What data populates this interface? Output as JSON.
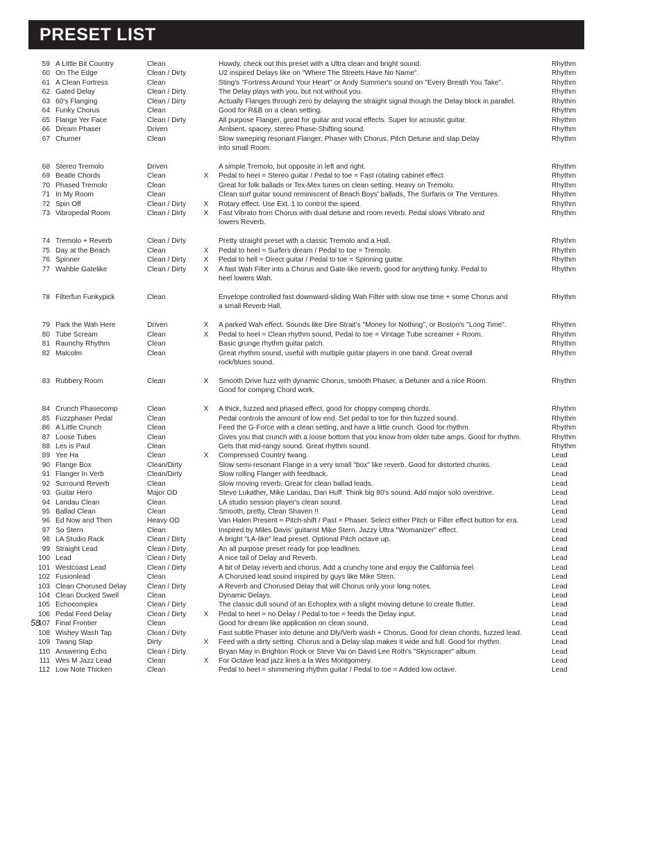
{
  "header": {
    "title": "PRESET LIST",
    "bar_color": "#231f20",
    "text_color": "#ffffff"
  },
  "page_number": "58",
  "columns": {
    "number": "",
    "name": "",
    "type": "",
    "pedal": "",
    "description": "",
    "category": ""
  },
  "rows": [
    {
      "num": "59",
      "name": "A Little Bit Country",
      "type": "Clean",
      "x": "",
      "desc": "Howdy, check out this preset with a Ultra clean and bright sound.",
      "cat": "Rhythm"
    },
    {
      "num": "60",
      "name": "On The Edge",
      "type": "Clean / Dirty",
      "x": "",
      "desc": "U2 inspired Delays like on \"Where The Streets Have No Name\".",
      "cat": "Rhythm"
    },
    {
      "num": "61",
      "name": "A Clean Fortress",
      "type": "Clean",
      "x": "",
      "desc": "Sting's \"Fortress Around Your Heart\" or Andy Summer's sound on \"Every Breath You Take\".",
      "cat": "Rhythm"
    },
    {
      "num": "62",
      "name": "Gated Delay",
      "type": "Clean / Dirty",
      "x": "",
      "desc": "The Delay plays with you, but not without you.",
      "cat": "Rhythm"
    },
    {
      "num": "63",
      "name": "60's Flanging",
      "type": "Clean / Dirty",
      "x": "",
      "desc": "Actually Flanges through zero by delaying the straight signal though the Delay block in parallel.",
      "cat": "Rhythm"
    },
    {
      "num": "64",
      "name": "Funky Chorus",
      "type": "Clean",
      "x": "",
      "desc": "Good for R&B on a clean setting.",
      "cat": "Rhythm"
    },
    {
      "num": "65",
      "name": "Flange Yer Face",
      "type": "Clean / Dirty",
      "x": "",
      "desc": "All purpose Flanger, great for guitar and vocal effects. Super for acoustic guitar.",
      "cat": "Rhythm"
    },
    {
      "num": "66",
      "name": "Dream Phaser",
      "type": "Driven",
      "x": "",
      "desc": "Ambient, spacey, stereo Phase-Shifting sound.",
      "cat": "Rhythm"
    },
    {
      "num": "67",
      "name": "Churner",
      "type": "Clean",
      "x": "",
      "desc": "Slow sweeping resonant Flanger, Phaser with Chorus, Pitch Detune and slap Delay",
      "cat": "Rhythm"
    },
    {
      "num": "",
      "name": "",
      "type": "",
      "x": "",
      "desc": "into small Room.",
      "cat": ""
    },
    {
      "spacer": true
    },
    {
      "num": "68",
      "name": "Stereo Tremolo",
      "type": "Driven",
      "x": "",
      "desc": "A simple Tremolo, but opposite in left and right.",
      "cat": "Rhythm"
    },
    {
      "num": "69",
      "name": "Beatle Chords",
      "type": "Clean",
      "x": "X",
      "desc": "Pedal to heel = Stereo guitar / Pedal to toe = Fast rotating cabinet effect.",
      "cat": "Rhythm"
    },
    {
      "num": "70",
      "name": "Phased Tremolo",
      "type": "Clean",
      "x": "",
      "desc": "Great for folk ballads or Tex-Mex tunes on clean setting. Heavy on Tremolo.",
      "cat": "Rhythm"
    },
    {
      "num": "71",
      "name": "In My Room",
      "type": "Clean",
      "x": "",
      "desc": "Clean surf guitar sound reminiscent of Beach Boys' ballads, The Surfaris or The Ventures.",
      "cat": "Rhythm"
    },
    {
      "num": "72",
      "name": "Spin Off",
      "type": "Clean / Dirty",
      "x": "X",
      "desc": "Rotary effect. Use Ext. 1 to control the speed.",
      "cat": "Rhythm"
    },
    {
      "num": "73",
      "name": "Vibropedal Room",
      "type": "Clean / Dirty",
      "x": "X",
      "desc": "Fast Vibrato from Chorus with dual detune and room reverb. Pedal slows Vibrato and",
      "cat": "Rhythm"
    },
    {
      "num": "",
      "name": "",
      "type": "",
      "x": "",
      "desc": "lowers Reverb.",
      "cat": ""
    },
    {
      "spacer": true
    },
    {
      "num": "74",
      "name": "Tremolo + Reverb",
      "type": "Clean / Dirty",
      "x": "",
      "desc": "Pretty straight preset with a classic Tremolo and a Hall.",
      "cat": "Rhythm"
    },
    {
      "num": "75",
      "name": "Day at the Beach",
      "type": "Clean",
      "x": "X",
      "desc": "Pedal to heel = Surfers dream / Pedal to toe = Tremolo.",
      "cat": "Rhythm"
    },
    {
      "num": "76",
      "name": "Spinner",
      "type": "Clean / Dirty",
      "x": "X",
      "desc": "Pedal to hell = Direct guitar / Pedal to toe = Spinning guitar.",
      "cat": "Rhythm"
    },
    {
      "num": "77",
      "name": "Wahble Gatelike",
      "type": "Clean / Dirty",
      "x": "X",
      "desc": "A fast Wah Filter into a Chorus and Gate-like reverb, good for anything funky. Pedal to",
      "cat": "Rhythm"
    },
    {
      "num": "",
      "name": "",
      "type": "",
      "x": "",
      "desc": "heel lowers Wah.",
      "cat": ""
    },
    {
      "spacer": true
    },
    {
      "num": "78",
      "name": "Filterfun Funkypick",
      "type": "Clean",
      "x": "",
      "desc": "Envelope controlled fast downward-sliding Wah Filter with slow rise time + some Chorus and",
      "cat": "Rhythm"
    },
    {
      "num": "",
      "name": "",
      "type": "",
      "x": "",
      "desc": "a small Reverb Hall.",
      "cat": ""
    },
    {
      "spacer": true
    },
    {
      "num": "79",
      "name": "Park the Wah Here",
      "type": "Driven",
      "x": "X",
      "desc": "A parked Wah effect. Sounds like Dire Strait's \"Money for Nothing\", or Boston's \"Long Time\".",
      "cat": "Rhythm"
    },
    {
      "num": "80",
      "name": "Tube Scream",
      "type": "Clean",
      "x": "X",
      "desc": "Pedal to heel = Clean rhythm sound, Pedal to toe = Vintage Tube screamer + Room.",
      "cat": "Rhythm"
    },
    {
      "num": "81",
      "name": "Raunchy Rhythm",
      "type": "Clean",
      "x": "",
      "desc": "Basic grunge rhythm guitar patch.",
      "cat": "Rhythm"
    },
    {
      "num": "82",
      "name": "Malcolm",
      "type": "Clean",
      "x": "",
      "desc": "Great rhythm sound, useful with multiple guitar players in one band. Great overall",
      "cat": "Rhythm"
    },
    {
      "num": "",
      "name": "",
      "type": "",
      "x": "",
      "desc": "rock/blues sound.",
      "cat": ""
    },
    {
      "spacer": true
    },
    {
      "num": "83",
      "name": "Rubbery Room",
      "type": "Clean",
      "x": "X",
      "desc": "Smooth Drive fuzz with dynamic Chorus, smooth Phaser, a Detuner and a nice Room.",
      "cat": "Rhythm"
    },
    {
      "num": "",
      "name": "",
      "type": "",
      "x": "",
      "desc": "Good for comping Chord work.",
      "cat": ""
    },
    {
      "spacer": true
    },
    {
      "num": "84",
      "name": "Crunch Phasecomp",
      "type": "Clean",
      "x": "X",
      "desc": "A thick, fuzzed and phased effect, good for choppy comping chords.",
      "cat": "Rhythm"
    },
    {
      "num": "85",
      "name": "Fuzzphaser Pedal",
      "type": "Clean",
      "x": "",
      "desc": "Pedal controls the amount of low end. Set pedal to toe for thin fuzzed sound.",
      "cat": "Rhythm"
    },
    {
      "num": "86",
      "name": "A Little Crunch",
      "type": "Clean",
      "x": "",
      "desc": "Feed the G-Force with a clean setting, and have a little crunch. Good for rhythm.",
      "cat": "Rhythm"
    },
    {
      "num": "87",
      "name": "Loose Tubes",
      "type": "Clean",
      "x": "",
      "desc": "Gives you that crunch with a loose bottom that you know from older tube amps. Good for rhythm.",
      "cat": "Rhythm"
    },
    {
      "num": "88",
      "name": "Les is Paul",
      "type": "Clean",
      "x": "",
      "desc": "Gets that mid-rangy sound. Great rhythm sound.",
      "cat": "Rhythm"
    },
    {
      "num": "89",
      "name": "Yee Ha",
      "type": "Clean",
      "x": "X",
      "desc": "Compressed Country twang.",
      "cat": "Lead"
    },
    {
      "num": "90",
      "name": "Flange Box",
      "type": "Clean/Dirty",
      "x": "",
      "desc": "Slow semi-resonant Flange in a very small \"box\" like reverb. Good for distorted chunks.",
      "cat": "Lead"
    },
    {
      "num": "91",
      "name": "Flanger In Verb",
      "type": "Clean/Dirty",
      "x": "",
      "desc": "Slow rolling Flanger with feedback.",
      "cat": "Lead"
    },
    {
      "num": "92",
      "name": "Surround Reverb",
      "type": "Clean",
      "x": "",
      "desc": "Slow moving reverb. Great for clean ballad leads.",
      "cat": "Lead"
    },
    {
      "num": "93",
      "name": "Guitar Hero",
      "type": "Major OD",
      "x": "",
      "desc": "Steve Lukather, Mike Landau, Dan Huff. Think big 80's sound. Add major solo overdrive.",
      "cat": "Lead"
    },
    {
      "num": "94",
      "name": "Landau Clean",
      "type": "Clean",
      "x": "",
      "desc": "LA studio session player's clean sound.",
      "cat": "Lead"
    },
    {
      "num": "95",
      "name": "Ballad Clean",
      "type": "Clean",
      "x": "",
      "desc": "Smooth, pretty, Clean Shaven !!",
      "cat": "Lead"
    },
    {
      "num": "96",
      "name": "Ed Now and Then",
      "type": "Heavy OD",
      "x": "",
      "desc": "Van Halen Present = Pitch-shift / Past = Phaser. Select either Pitch or Filter effect button for era.",
      "cat": "Lead"
    },
    {
      "num": "97",
      "name": "So Stern",
      "type": "Clean",
      "x": "",
      "desc": "Inspired by Miles Davis' guitarist Mike Stern. Jazzy Ultra \"Womanizer\" effect.",
      "cat": "Lead"
    },
    {
      "num": "98",
      "name": "LA Studio Rack",
      "type": "Clean / Dirty",
      "x": "",
      "desc": "A bright \"LA-like\" lead preset. Optional Pitch octave up.",
      "cat": "Lead"
    },
    {
      "num": "99",
      "name": "Straight Lead",
      "type": "Clean / Dirty",
      "x": "",
      "desc": "An all purpose preset ready for pop leadlines.",
      "cat": "Lead"
    },
    {
      "num": "100",
      "name": "Lead",
      "type": "Clean / Dirty",
      "x": "",
      "desc": "A nice tail of Delay and Reverb.",
      "cat": "Lead"
    },
    {
      "num": "101",
      "name": "Westcoast Lead",
      "type": "Clean / Dirty",
      "x": "",
      "desc": "A bit of Delay reverb and chorus. Add a crunchy tone and enjoy the California feel.",
      "cat": "Lead"
    },
    {
      "num": "102",
      "name": "Fusionlead",
      "type": "Clean",
      "x": "",
      "desc": "A Chorused lead sound inspired by guys like Mike Stern.",
      "cat": "Lead"
    },
    {
      "num": "103",
      "name": "Clean Chorused Delay",
      "type": "Clean / Dirty",
      "x": "",
      "desc": "A Reverb and Chorused Delay that will Chorus only your long notes.",
      "cat": "Lead"
    },
    {
      "num": "104",
      "name": "Clean Ducked Swell",
      "type": "Clean",
      "x": "",
      "desc": "Dynamic Delays.",
      "cat": "Lead"
    },
    {
      "num": "105",
      "name": "Echocomplex",
      "type": "Clean / Dirty",
      "x": "",
      "desc": "The classic dull sound of an Echoplex with a slight moving detune to create flutter.",
      "cat": "Lead"
    },
    {
      "num": "106",
      "name": "Pedal Feed Delay",
      "type": "Clean / Dirty",
      "x": "X",
      "desc": "Pedal to heel = no Delay / Pedal to toe = feeds the Delay input.",
      "cat": "Lead"
    },
    {
      "num": "107",
      "name": "Final Frontier",
      "type": "Clean",
      "x": "",
      "desc": "Good for dream like application on clean sound.",
      "cat": "Lead"
    },
    {
      "num": "108",
      "name": "Wishey Wash Tap",
      "type": "Clean / Dirty",
      "x": "",
      "desc": "Fast subtle Phaser into detune and Dly/Verb wash + Chorus. Good for clean chords, fuzzed lead.",
      "cat": "Lead"
    },
    {
      "num": "109",
      "name": "Twang Slap",
      "type": "Dirty",
      "x": "X",
      "desc": "Feed with a dirty setting. Chorus and a Delay slap makes it wide and full. Good for rhythm.",
      "cat": "Lead"
    },
    {
      "num": "110",
      "name": "Answering Echo",
      "type": "Clean / Dirty",
      "x": "",
      "desc": "Bryan May in Brighton Rock or Steve Vai on David Lee Roth's \"Skyscraper\" album.",
      "cat": "Lead"
    },
    {
      "num": "111",
      "name": "Wes M Jazz Lead",
      "type": "Clean",
      "x": "X",
      "desc": "For Octave lead jazz lines a la Wes Montgomery.",
      "cat": "Lead"
    },
    {
      "num": "112",
      "name": "Low Note Thicken",
      "type": "Clean",
      "x": "",
      "desc": "Pedal to heel = shimmering rhythm guitar / Pedal to toe = Added low octave.",
      "cat": "Lead"
    }
  ]
}
